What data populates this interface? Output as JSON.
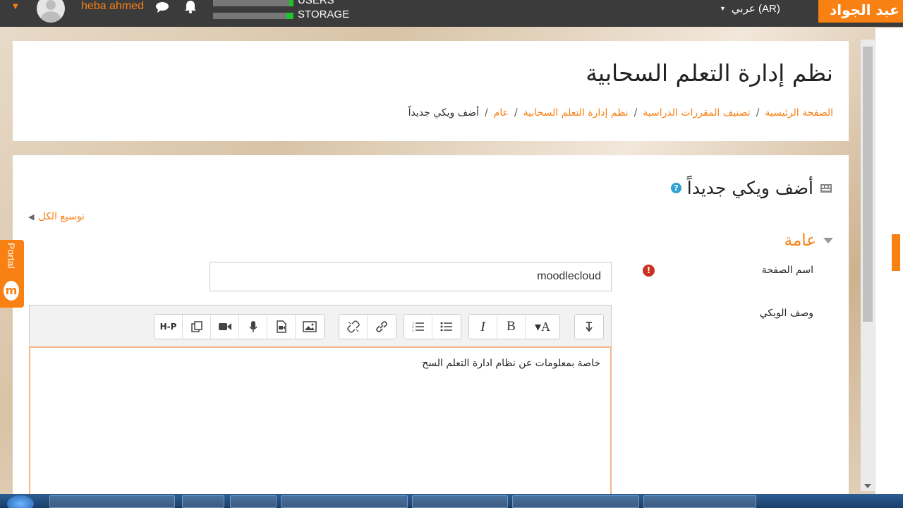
{
  "navbar": {
    "username": "heba ahmed",
    "users_label": "USERS",
    "storage_label": "STORAGE",
    "users_fill_pct": 5,
    "storage_fill_pct": 9,
    "language": "عربي (AR)",
    "site_name": "أحمد عبد الجواد"
  },
  "header": {
    "title": "نظم إدارة التعلم السحابية",
    "breadcrumb": [
      "الصفحة الرئيسية",
      "تصنيف المقررات الدراسية",
      "نظم إدارة التعلم السحابية",
      "عام",
      "أضف ويكي جديداً"
    ]
  },
  "form": {
    "heading": "أضف ويكي جديداً",
    "expand_all": "توسيع الكل",
    "section_general": "عامة",
    "page_name_label": "اسم الصفحة",
    "page_name_value": "moodlecloud",
    "description_label": "وصف الويكي",
    "editor_text": "خاصة بمعلومات عن نظام ادارة التعلم السح"
  },
  "toolbar": {
    "h5p": "H-P",
    "bold": "B",
    "italic": "I",
    "font_color": "▾A"
  },
  "portal": {
    "label": "Portal",
    "logo": "m"
  },
  "colors": {
    "accent": "#f98012",
    "navbar": "#3b3b3b",
    "required": "#ca3120",
    "help": "#31a2d3"
  }
}
